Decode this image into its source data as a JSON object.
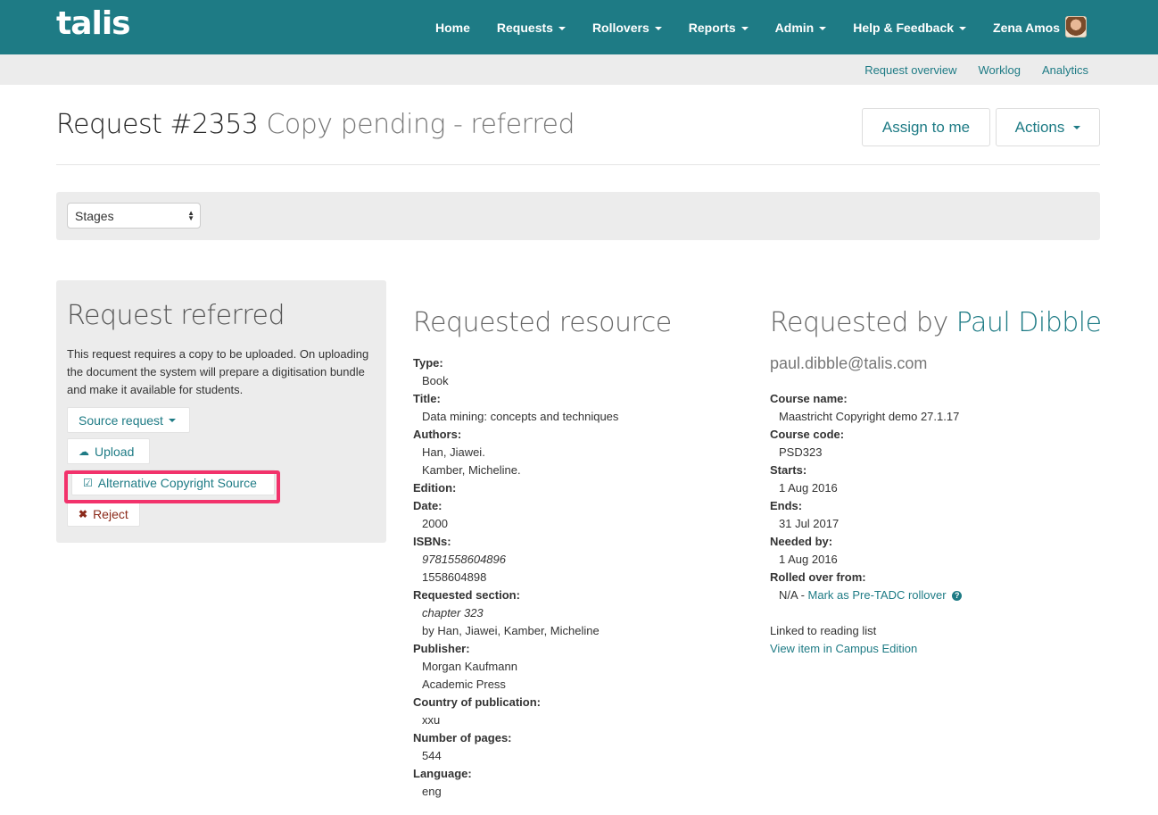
{
  "app": {
    "logo": "talis"
  },
  "nav": {
    "items": [
      {
        "label": "Home",
        "dropdown": false
      },
      {
        "label": "Requests",
        "dropdown": true
      },
      {
        "label": "Rollovers",
        "dropdown": true
      },
      {
        "label": "Reports",
        "dropdown": true
      },
      {
        "label": "Admin",
        "dropdown": true
      },
      {
        "label": "Help & Feedback",
        "dropdown": true
      }
    ],
    "user_name": "Zena Amos"
  },
  "subnav": {
    "items": [
      "Request overview",
      "Worklog",
      "Analytics"
    ]
  },
  "header": {
    "title": "Request #2353",
    "status": "Copy pending - referred",
    "assign_label": "Assign to me",
    "actions_label": "Actions"
  },
  "stages": {
    "selected": "Stages"
  },
  "panel": {
    "heading": "Request referred",
    "text": "This request requires a copy to be uploaded. On uploading the document the system will prepare a digitisation bundle and make it available for students.",
    "source_label": "Source request",
    "upload_label": "Upload",
    "alt_label": "Alternative Copyright Source",
    "reject_label": "Reject"
  },
  "resource": {
    "heading": "Requested resource",
    "type_label": "Type:",
    "type": "Book",
    "title_label": "Title:",
    "title": "Data mining: concepts and techniques",
    "authors_label": "Authors:",
    "authors": [
      "Han, Jiawei.",
      "Kamber, Micheline."
    ],
    "edition_label": "Edition:",
    "date_label": "Date:",
    "date": "2000",
    "isbns_label": "ISBNs:",
    "isbns": [
      "9781558604896",
      "1558604898"
    ],
    "section_label": "Requested section:",
    "section": "chapter 323",
    "section_by": "by Han, Jiawei, Kamber, Micheline",
    "publisher_label": "Publisher:",
    "publishers": [
      "Morgan Kaufmann",
      "Academic Press"
    ],
    "country_label": "Country of publication:",
    "country": "xxu",
    "pages_label": "Number of pages:",
    "pages": "544",
    "language_label": "Language:",
    "language": "eng"
  },
  "requester": {
    "heading_prefix": "Requested by",
    "name": "Paul Dibble",
    "email": "paul.dibble@talis.com",
    "course_name_label": "Course name:",
    "course_name": "Maastricht Copyright demo 27.1.17",
    "course_code_label": "Course code:",
    "course_code": "PSD323",
    "starts_label": "Starts:",
    "starts": "1 Aug 2016",
    "ends_label": "Ends:",
    "ends": "31 Jul 2017",
    "needed_label": "Needed by:",
    "needed": "1 Aug 2016",
    "rolled_label": "Rolled over from:",
    "rolled_value": "N/A -",
    "rolled_link": "Mark as Pre-TADC rollover",
    "linked_text": "Linked to reading list",
    "view_link": "View item in Campus Edition"
  }
}
